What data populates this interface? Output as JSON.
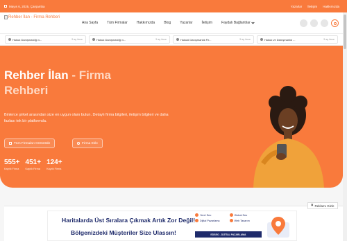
{
  "topbar": {
    "date": "Mayıs 6, 2025, Çarşamba",
    "links": [
      "Yazarlar",
      "İletişim",
      "Hakkımızda"
    ]
  },
  "header": {
    "logo_text": "Rehber İlan - Firma Rehberi",
    "nav": [
      "Ana Sayfa",
      "Tüm Firmalar",
      "Hakkımızda",
      "Blog",
      "Yazarlar",
      "İletişim",
      "Faydalı Bağlantılar"
    ]
  },
  "ticker": {
    "items": [
      {
        "title": "Hukuk Danışmanlığı v...",
        "ago": "5 ay önce"
      },
      {
        "title": "Hukuk Danışmanlığı v...",
        "ago": "5 ay önce"
      },
      {
        "title": "Hukuki Danışmanlık Fir...",
        "ago": "5 ay önce"
      },
      {
        "title": "Hukuk ve Danışmanlık ...",
        "ago": "5 ay önce"
      }
    ]
  },
  "hero": {
    "title_a": "Rehber İlan",
    "title_sep": " - ",
    "title_b": "Firma",
    "title_c": "Rehberi",
    "description": "Binlerce şirket arasından size en uygun olanı bulun. Detaylı firma bilgileri, iletişim bilgileri ve daha fazlası tek bir platformda.",
    "btn_all": "Tüm Firmaları Görüntüle",
    "btn_add": "Firma Ekle",
    "stats": [
      {
        "number": "555+",
        "label": "Kayıtlı Firma"
      },
      {
        "number": "451+",
        "label": "Kayıtlı Firma"
      },
      {
        "number": "124+",
        "label": "Kayıtlı Firma"
      }
    ]
  },
  "ad": {
    "line1": "Haritalarda Üst Sıralara Çıkmak Artık Zor Değil!",
    "line2": "Bölgenizdeki Müşteriler Size Ulassın!",
    "features": [
      "Yerel Seo",
      "Global Seo",
      "Dijital Pazarlama",
      "Web Tasarım"
    ],
    "strip": "EDSEO - DİJİTAL PAZARLAMA",
    "close_label": "Reklamı Gizle"
  },
  "colors": {
    "accent": "#f97a3c",
    "navy": "#1f2b6b"
  }
}
